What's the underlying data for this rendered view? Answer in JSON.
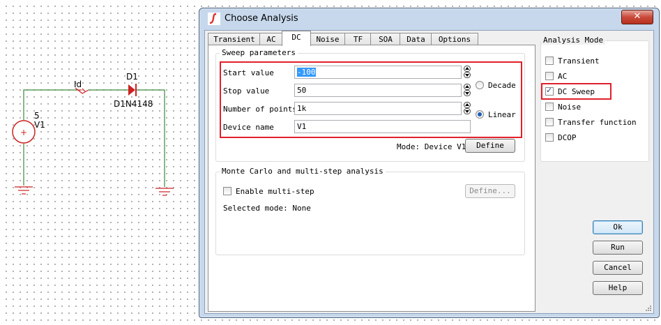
{
  "schematic": {
    "source_value": "5",
    "source_name": "V1",
    "ammeter_name": "Id",
    "diode_name": "D1",
    "diode_model": "D1N4148",
    "source_symbol": "+"
  },
  "window": {
    "title": "Choose Analysis",
    "close_label": "✕"
  },
  "tabs": [
    {
      "label": "Transient"
    },
    {
      "label": "AC"
    },
    {
      "label": "DC"
    },
    {
      "label": "Noise"
    },
    {
      "label": "TF"
    },
    {
      "label": "SOA"
    },
    {
      "label": "Data"
    },
    {
      "label": "Options"
    }
  ],
  "sweep": {
    "group_label": "Sweep parameters",
    "start_label": "Start value",
    "start_value": "-100",
    "stop_label": "Stop value",
    "stop_value": "50",
    "points_label": "Number of points",
    "points_value": "1k",
    "device_label": "Device name",
    "device_value": "V1",
    "decade_label": "Decade",
    "linear_label": "Linear",
    "selected_scale": "Linear",
    "mode_text": "Mode: Device V1",
    "define_label": "Define"
  },
  "montecarlo": {
    "group_label": "Monte Carlo and multi-step analysis",
    "enable_label": "Enable multi-step",
    "enable_checked": false,
    "define_label": "Define...",
    "selected_mode_text": "Selected mode: None"
  },
  "analysis_mode": {
    "group_label": "Analysis Mode",
    "items": [
      {
        "label": "Transient",
        "checked": false
      },
      {
        "label": "AC",
        "checked": false
      },
      {
        "label": "DC Sweep",
        "checked": true
      },
      {
        "label": "Noise",
        "checked": false
      },
      {
        "label": "Transfer function",
        "checked": false
      },
      {
        "label": "DCOP",
        "checked": false
      }
    ],
    "check_glyph": "✓"
  },
  "buttons": {
    "ok": "Ok",
    "run": "Run",
    "cancel": "Cancel",
    "help": "Help"
  },
  "colors": {
    "highlight": "#e0202c",
    "wire": "#3a8a3a",
    "component": "#cc2222"
  }
}
